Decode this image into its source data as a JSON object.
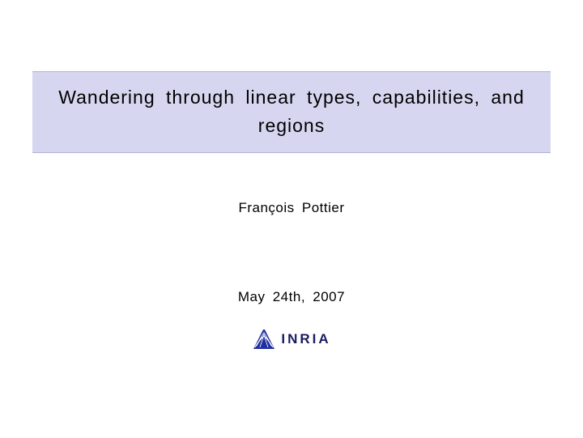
{
  "slide": {
    "title": "Wandering through linear types, capabilities, and regions",
    "author": "François Pottier",
    "date": "May 24th, 2007",
    "logo_text": "INRIA"
  }
}
